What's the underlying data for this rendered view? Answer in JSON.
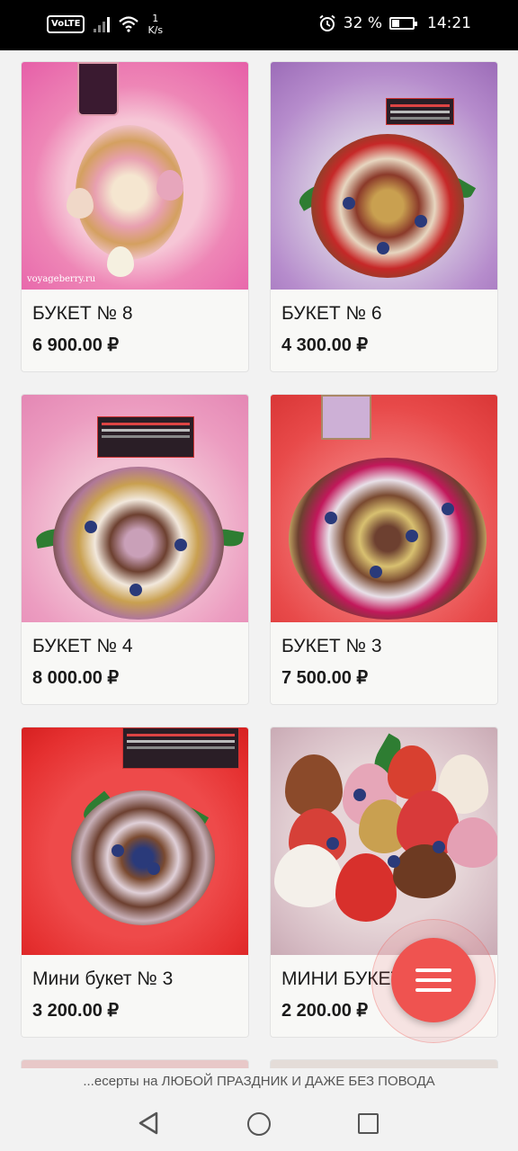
{
  "status_bar": {
    "network_badge": "VoLTE",
    "speed_value": "1",
    "speed_unit": "K/s",
    "battery": "32 %",
    "battery_level": 0.32,
    "time": "14:21",
    "icons": [
      "signal-icon",
      "wifi-icon",
      "alarm-icon",
      "battery-icon"
    ]
  },
  "products": [
    {
      "name": "БУКЕТ № 8",
      "price": "6 900.00 ₽",
      "watermark": "voyageberry.ru"
    },
    {
      "name": "БУКЕТ № 6",
      "price": "4 300.00 ₽"
    },
    {
      "name": "БУКЕТ № 4",
      "price": "8 000.00 ₽"
    },
    {
      "name": "БУКЕТ № 3",
      "price": "7 500.00 ₽"
    },
    {
      "name": "Мини букет № 3",
      "price": "3 200.00 ₽"
    },
    {
      "name": "МИНИ БУКЕТ № 2",
      "price": "2 200.00 ₽"
    }
  ],
  "ticker": "...есерты на ЛЮБОЙ ПРАЗДНИК И ДАЖЕ БЕЗ ПОВОДА",
  "fab": {
    "icon": "menu-icon"
  },
  "colors": {
    "fab": "#ef5350",
    "text": "#1a1a1a",
    "card_bg": "#f8f8f6"
  }
}
